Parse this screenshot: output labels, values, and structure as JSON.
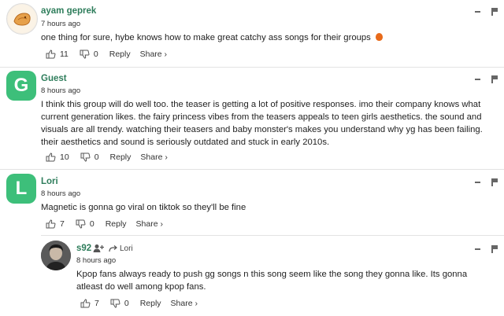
{
  "comments": [
    {
      "author": "ayam geprek",
      "time": "7 hours ago",
      "text": "one thing for sure, hybe knows how to make great catchy ass songs for their groups",
      "likes": "11",
      "dislikes": "0",
      "reply": "Reply",
      "share": "Share ›"
    },
    {
      "avatar_letter": "G",
      "author": "Guest",
      "time": "8 hours ago",
      "text": "I think this group will do well too. the teaser is getting a lot of positive responses. imo their company knows what current generation likes. the fairy princess vibes from the teasers appeals to teen girls aesthetics. the sound and visuals are all trendy. watching their teasers and baby monster's makes you understand why yg has been failing. their aesthetics and sound is seriously outdated and stuck in early 2010s.",
      "likes": "10",
      "dislikes": "0",
      "reply": "Reply",
      "share": "Share ›"
    },
    {
      "avatar_letter": "L",
      "author": "Lori",
      "time": "8 hours ago",
      "text": "Magnetic is gonna go viral on tiktok so they'll be fine",
      "likes": "7",
      "dislikes": "0",
      "reply": "Reply",
      "share": "Share ›"
    },
    {
      "author": "s92",
      "reply_to": "Lori",
      "time": "8 hours ago",
      "text": "Kpop fans always ready to push gg songs n this song seem like the song they gonna like. Its gonna atleast do well among kpop fans.",
      "likes": "7",
      "dislikes": "0",
      "reply": "Reply",
      "share": "Share ›"
    }
  ],
  "colors": {
    "accent": "#2e7d5b",
    "avatar_green": "#3dbf7a"
  }
}
